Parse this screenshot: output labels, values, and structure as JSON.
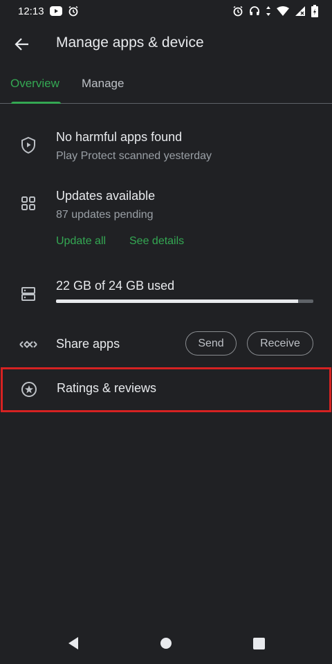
{
  "status_bar": {
    "time": "12:13",
    "icons_left": [
      "youtube-icon",
      "alarm-icon"
    ],
    "icons_right": [
      "alarm-icon",
      "headphones-icon",
      "data-arrows-icon",
      "wifi-icon",
      "signal-icon",
      "battery-icon"
    ]
  },
  "app_bar": {
    "title": "Manage apps & device",
    "back_icon": "arrow-back-icon"
  },
  "tabs": [
    {
      "label": "Overview",
      "active": true
    },
    {
      "label": "Manage",
      "active": false
    }
  ],
  "protect": {
    "icon": "shield-play-icon",
    "title": "No harmful apps found",
    "subtitle": "Play Protect scanned yesterday"
  },
  "updates": {
    "icon": "apps-grid-icon",
    "title": "Updates available",
    "subtitle": "87 updates pending",
    "update_all": "Update all",
    "see_details": "See details"
  },
  "storage": {
    "icon": "storage-icon",
    "title": "22 GB of 24 GB used",
    "used_fraction": 0.94
  },
  "share": {
    "icon": "share-nearby-icon",
    "title": "Share apps",
    "send": "Send",
    "receive": "Receive"
  },
  "ratings": {
    "icon": "star-circle-icon",
    "title": "Ratings & reviews"
  },
  "colors": {
    "background": "#202124",
    "accent": "#34a853",
    "highlight": "#d62222"
  },
  "nav_bar": {
    "icons": [
      "back-triangle-icon",
      "home-circle-icon",
      "recents-square-icon"
    ]
  }
}
